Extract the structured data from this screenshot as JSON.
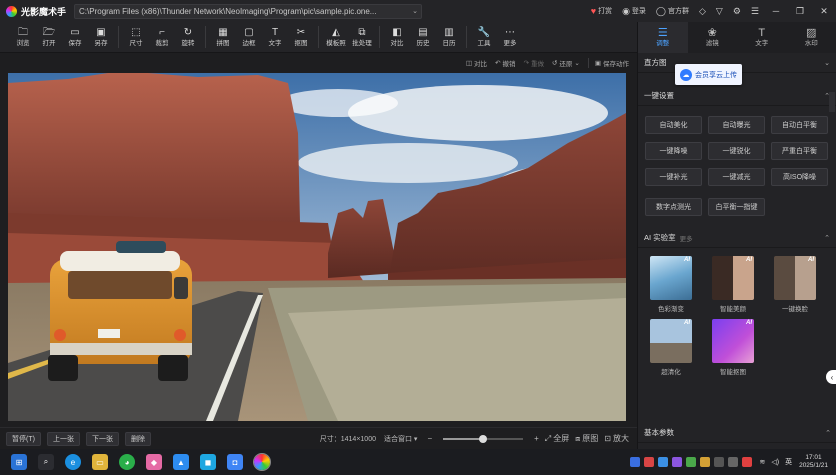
{
  "app": {
    "name": "光影魔术手",
    "path": "C:\\Program Files (x86)\\Thunder Network\\NeoImaging\\Program\\pic\\sample.pic.one...",
    "titlebar": {
      "promo": "打赏",
      "login": "登录",
      "official": "官方群"
    }
  },
  "toolbar": [
    {
      "icon": "folder-icon",
      "label": "浏览"
    },
    {
      "icon": "open-icon",
      "label": "打开"
    },
    {
      "icon": "save-icon",
      "label": "保存"
    },
    {
      "icon": "save-as-icon",
      "label": "另存"
    },
    {
      "icon": "size-icon",
      "label": "尺寸"
    },
    {
      "icon": "crop-icon",
      "label": "裁剪"
    },
    {
      "icon": "rotate-icon",
      "label": "旋转"
    },
    {
      "icon": "collage-icon",
      "label": "拼图"
    },
    {
      "icon": "border-icon",
      "label": "边框"
    },
    {
      "icon": "text-icon",
      "label": "文字"
    },
    {
      "icon": "matting-icon",
      "label": "抠图"
    },
    {
      "icon": "watermark-icon",
      "label": "模板照"
    },
    {
      "icon": "batch-icon",
      "label": "批处理"
    },
    {
      "icon": "compare-icon",
      "label": "对比"
    },
    {
      "icon": "history-icon",
      "label": "历史"
    },
    {
      "icon": "tools-icon",
      "label": "工具"
    },
    {
      "icon": "more-icon",
      "label": "更多"
    }
  ],
  "subbar": {
    "compare": "对比",
    "undo": "撤销",
    "redo": "重做",
    "restore": "还原",
    "save_action": "保存动作"
  },
  "bottombar": {
    "mode": "暂停(T)",
    "prev": "上一张",
    "next": "下一张",
    "delete": "删除",
    "size_info": "尺寸：1414×1000",
    "fit_label": "适合窗口",
    "fit_full": "全屏",
    "original": "原图",
    "zoom": "放大",
    "zoom_fraction": 0.5
  },
  "panel": {
    "tabs": [
      {
        "icon": "adjust-icon",
        "label": "调整"
      },
      {
        "icon": "filter-icon",
        "label": "滤镜"
      },
      {
        "icon": "text-tab-icon",
        "label": "文字"
      },
      {
        "icon": "watermark-tab-icon",
        "label": "水印"
      }
    ],
    "histogram": "直方图",
    "cloud_button": "会员享云上传",
    "one_click": "一键设置",
    "presets": [
      "自动美化",
      "自动曝光",
      "自动白平衡",
      "一键降噪",
      "一键锐化",
      "严重白平衡",
      "一键补光",
      "一键减光",
      "高ISO降噪",
      "数字点测光",
      "白平衡一指键"
    ],
    "ai_title": "AI 实验室",
    "ai_sub": "更多",
    "ai_items": [
      {
        "label": "色彩渐变",
        "badge": "AI"
      },
      {
        "label": "智能美颜",
        "badge": "AI"
      },
      {
        "label": "一键换脸",
        "badge": "AI"
      },
      {
        "label": "超清化",
        "badge": "AI"
      },
      {
        "label": "智能抠图",
        "badge": "AI"
      }
    ],
    "basic": "基本参数"
  },
  "taskbar": {
    "time": "17:01",
    "date": "2025/1/21",
    "lang": "英"
  }
}
